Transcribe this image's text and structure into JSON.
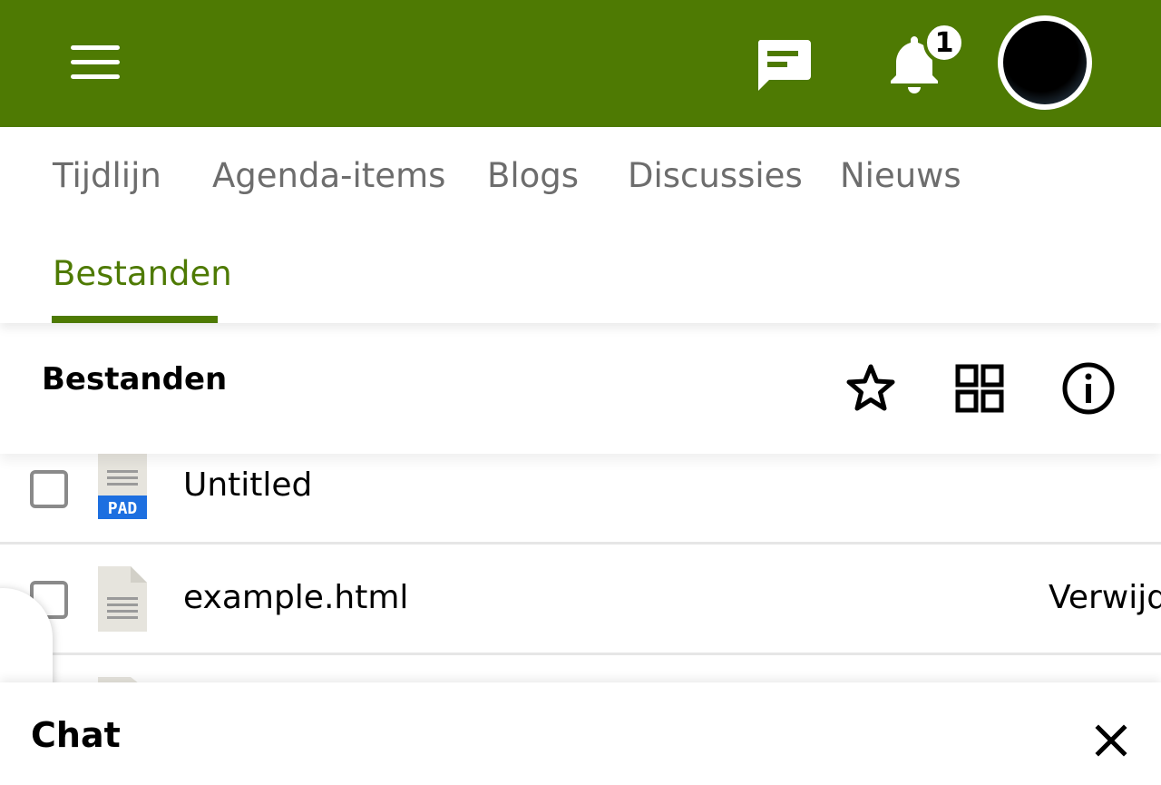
{
  "topbar": {
    "color": "#4e7a03",
    "menu_icon": "hamburger-menu-icon",
    "messages_icon": "chat-bubble-icon",
    "notifications_icon": "bell-icon",
    "notification_count": "1",
    "avatar": "user-avatar"
  },
  "tabs": [
    {
      "label": "Tijdlijn",
      "active": false
    },
    {
      "label": "Agenda-items",
      "active": false
    },
    {
      "label": "Blogs",
      "active": false
    },
    {
      "label": "Discussies",
      "active": false
    },
    {
      "label": "Nieuws",
      "active": false
    },
    {
      "label": "Bestanden",
      "active": true
    }
  ],
  "section": {
    "title": "Bestanden",
    "icons": [
      "star-icon",
      "grid-view-icon",
      "info-icon"
    ]
  },
  "files": [
    {
      "name": "Untitled",
      "type_icon": "pad-file-icon",
      "type_label": "PAD",
      "action": ""
    },
    {
      "name": "example.html",
      "type_icon": "document-file-icon",
      "action": "Verwijd"
    }
  ],
  "chat": {
    "title": "Chat",
    "close_icon": "close-icon"
  }
}
